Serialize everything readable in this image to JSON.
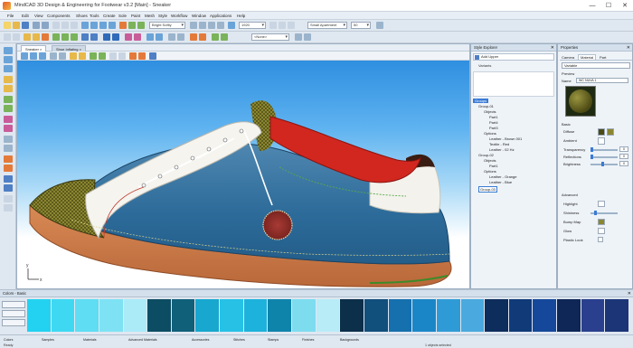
{
  "window": {
    "title": "MindCAD 3D Design & Engineering for Footwear v3.2 [Main] - Sneaker",
    "minimize": "—",
    "maximize": "☐",
    "close": "✕"
  },
  "menu": [
    "File",
    "Edit",
    "View",
    "Components",
    "Shoes",
    "Tools",
    "Create",
    "Sole",
    "Paint",
    "Mesh",
    "Style",
    "Workflow",
    "Window",
    "Applications",
    "Help"
  ],
  "toolbar": {
    "combo1": "Bright Softly",
    "combo2": "1920",
    "combo3": "<None>",
    "combo4": "Small Apartment",
    "combo5": "50"
  },
  "viewport": {
    "tabs": [
      "Sneaker ×",
      "Shoe Inflating ×"
    ]
  },
  "style_explorer": {
    "title": "Style Explorer",
    "toolbar_label": "Add Upper",
    "sub_label": "Variants",
    "tree": [
      {
        "label": "Groups",
        "level": 0,
        "state": "selected"
      },
      {
        "label": "Group-01",
        "level": 1
      },
      {
        "label": "Objects",
        "level": 2
      },
      {
        "label": "Part1",
        "level": 3
      },
      {
        "label": "Part4",
        "level": 3
      },
      {
        "label": "Part3",
        "level": 3
      },
      {
        "label": "Options",
        "level": 2
      },
      {
        "label": "Leather - Brown 001",
        "level": 3
      },
      {
        "label": "Textile - Red",
        "level": 3
      },
      {
        "label": "Leather - 02 Hz",
        "level": 3
      },
      {
        "label": "Group-02",
        "level": 1
      },
      {
        "label": "Objects",
        "level": 2
      },
      {
        "label": "Part1",
        "level": 3
      },
      {
        "label": "Options",
        "level": 2
      },
      {
        "label": "Leather - Orange",
        "level": 3
      },
      {
        "label": "Leather - Blue",
        "level": 3
      },
      {
        "label": "Group-03",
        "level": 1,
        "state": "editing"
      }
    ]
  },
  "properties": {
    "title": "Properties",
    "tabs": [
      "Camera",
      "Material",
      "Part"
    ],
    "mode": "Variable",
    "preview_label": "Preview",
    "name_label": "Name",
    "name_value": "WC NUVA 1",
    "basic_label": "Basic",
    "rows": [
      "Diffuse",
      "Ambient",
      "Transparency",
      "Reflections",
      "Brightness"
    ],
    "values": [
      "0",
      "0",
      "0"
    ],
    "advanced_label": "Advanced",
    "adv_rows": [
      "Highlight",
      "Shininess",
      "Bump Map",
      "Glow",
      "Plastic Look"
    ]
  },
  "palette": {
    "title": "Colors - Basic",
    "colors": [
      "#22d2f0",
      "#3ed8f2",
      "#5fddf3",
      "#7ee2f4",
      "#abebf8",
      "#0d4d63",
      "#10607a",
      "#17a7cf",
      "#27c1e6",
      "#1db2dc",
      "#0f84ab",
      "#7edcef",
      "#b8ecf7",
      "#0c2f4a",
      "#114f7c",
      "#1570ad",
      "#1b86c7",
      "#2f9bd6",
      "#4aa9de",
      "#0d2d5c",
      "#103a78",
      "#15489a",
      "#0e2756",
      "#2a3f8e",
      "#1b3577"
    ]
  },
  "statusbar": {
    "tabs": [
      "Colors",
      "Samples",
      "Materials",
      "Advanced Materials",
      "Accessories",
      "Stitches",
      "Stamps",
      "Finishes",
      "Backgrounds"
    ],
    "ready": "Ready",
    "info": "1 objects selected"
  },
  "scene": {
    "axis_x": "x",
    "axis_y": "y"
  }
}
